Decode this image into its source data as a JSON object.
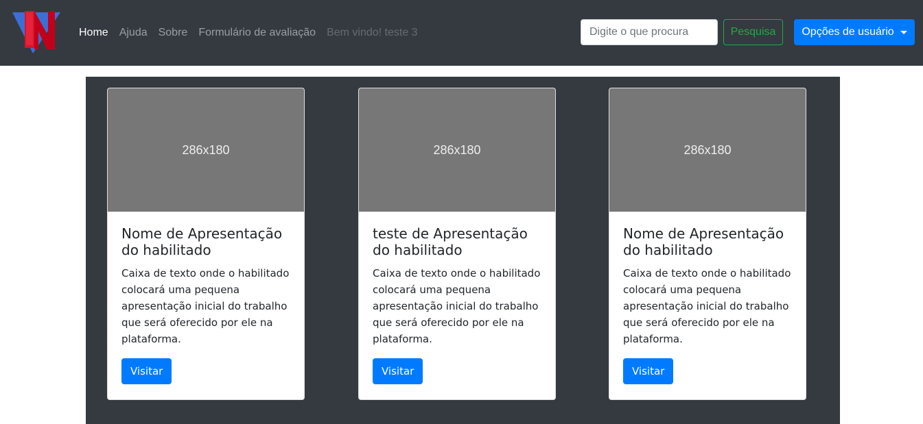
{
  "navbar": {
    "logo_icon": "logo-icon",
    "links": [
      {
        "label": "Home"
      },
      {
        "label": "Ajuda"
      },
      {
        "label": "Sobre"
      },
      {
        "label": "Formulário de avaliação"
      },
      {
        "label": "Bem vindo! teste 3"
      }
    ],
    "search_placeholder": "Digite o que procura",
    "search_value": "",
    "search_button": "Pesquisa",
    "user_menu": "Opções de usuário",
    "user_menu_icon": "caret-down-icon"
  },
  "cards": [
    {
      "image_label": "286x180",
      "title": "Nome de Apresentação do habilitado",
      "text": "Caixa de texto onde o habilitado colocará uma pequena apresentação inicial do trabalho que será oferecido por ele na plataforma.",
      "button": "Visitar"
    },
    {
      "image_label": "286x180",
      "title": "teste de Apresentação do habilitado",
      "text": "Caixa de texto onde o habilitado colocará uma pequena apresentação inicial do trabalho que será oferecido por ele na plataforma.",
      "button": "Visitar"
    },
    {
      "image_label": "286x180",
      "title": "Nome de Apresentação do habilitado",
      "text": "Caixa de texto onde o habilitado colocará uma pequena apresentação inicial do trabalho que será oferecido por ele na plataforma.",
      "button": "Visitar"
    }
  ],
  "colors": {
    "navbar_bg": "#343a40",
    "primary": "#007bff",
    "success": "#28a745",
    "placeholder_img": "#777777"
  }
}
